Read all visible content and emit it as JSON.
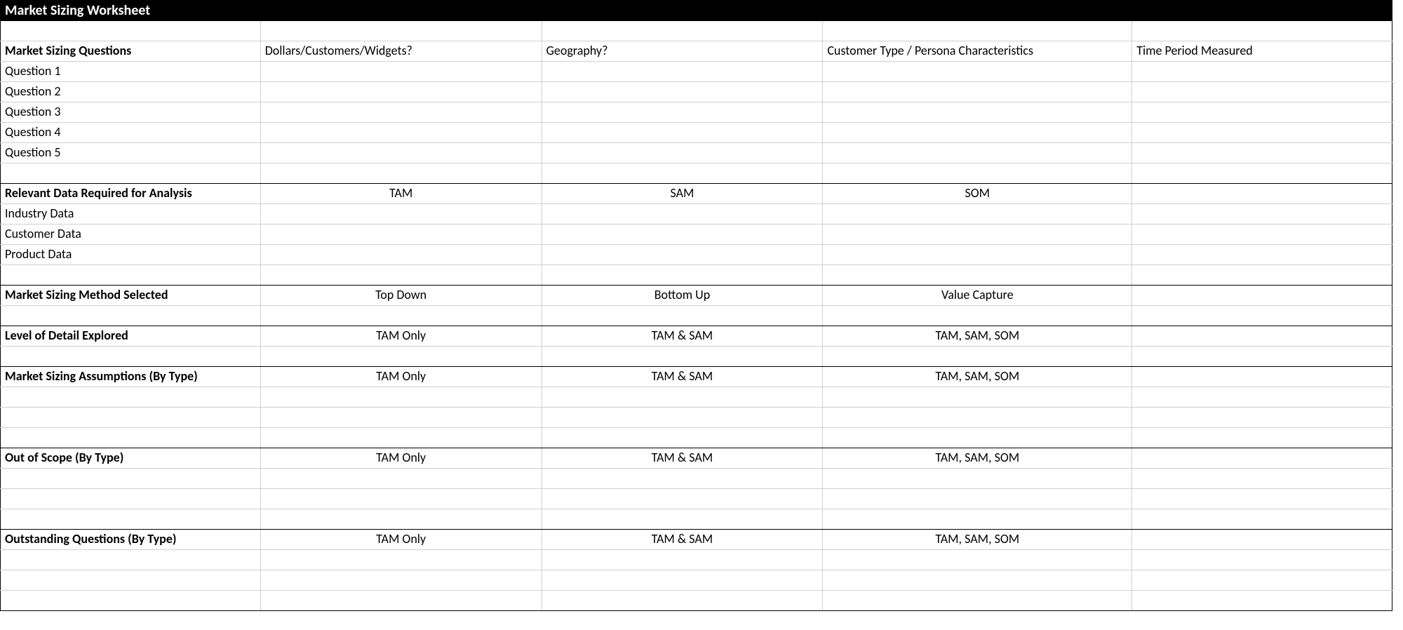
{
  "title": "Market Sizing Worksheet",
  "sections": {
    "questions": {
      "label": "Market Sizing Questions",
      "cols": [
        "Dollars/Customers/Widgets?",
        "Geography?",
        "Customer Type / Persona Characteristics",
        "Time Period Measured"
      ],
      "rows": [
        "Question 1",
        "Question 2",
        "Question 3",
        "Question 4",
        "Question 5"
      ]
    },
    "data_required": {
      "label": "Relevant Data Required for Analysis",
      "cols": [
        "TAM",
        "SAM",
        "SOM",
        ""
      ],
      "rows": [
        "Industry Data",
        "Customer Data",
        "Product Data"
      ]
    },
    "method": {
      "label": "Market Sizing Method Selected",
      "cols": [
        "Top Down",
        "Bottom Up",
        "Value Capture",
        ""
      ]
    },
    "detail": {
      "label": "Level of Detail Explored",
      "cols": [
        "TAM Only",
        "TAM & SAM",
        "TAM, SAM, SOM",
        ""
      ]
    },
    "assumptions": {
      "label": "Market Sizing Assumptions (By Type)",
      "cols": [
        "TAM Only",
        "TAM & SAM",
        "TAM, SAM, SOM",
        ""
      ]
    },
    "out_of_scope": {
      "label": "Out of Scope (By Type)",
      "cols": [
        "TAM Only",
        "TAM & SAM",
        "TAM, SAM, SOM",
        ""
      ]
    },
    "outstanding": {
      "label": "Outstanding Questions (By Type)",
      "cols": [
        "TAM Only",
        "TAM & SAM",
        "TAM, SAM, SOM",
        ""
      ]
    }
  }
}
